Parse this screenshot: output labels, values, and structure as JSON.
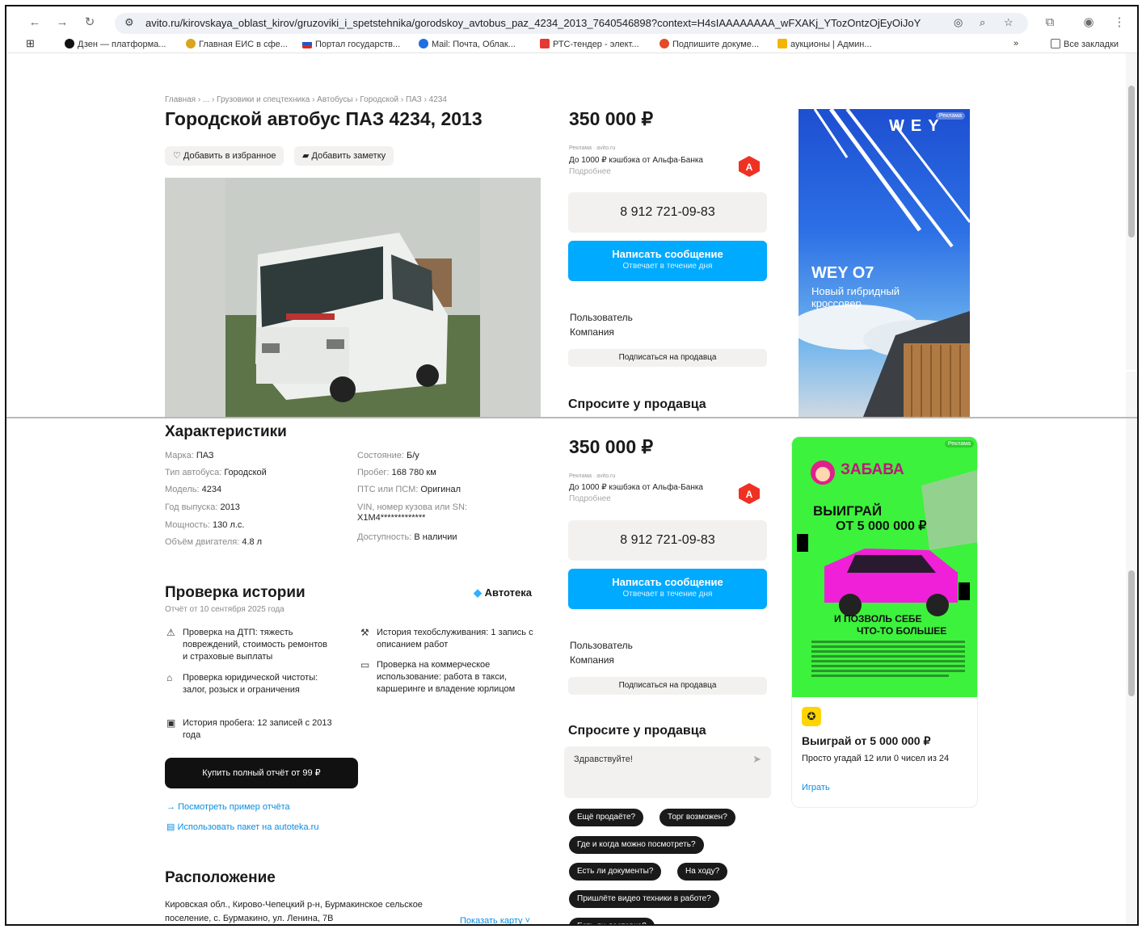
{
  "browser": {
    "url": "avito.ru/kirovskaya_oblast_kirov/gruzoviki_i_spetstehnika/gorodskoy_avtobus_paz_4234_2013_7640546898?context=H4sIAAAAAAAA_wFXAKj_YTozOntzOjEyOiJoYXNHZ...",
    "bookmarks": [
      "Дзен — платформа...",
      "Главная ЕИС в сфе...",
      "Портал государств...",
      "Mail: Почта, Облак...",
      "РТС-тендер - элект...",
      "Подпишите докуме...",
      "аукционы | Админ..."
    ],
    "all_bookmarks": "Все закладки",
    "colors": {
      "accent": "#00aaff",
      "dark": "#1a1a1a"
    }
  },
  "listing": {
    "breadcrumbs": "Главная › ... › Грузовики и спецтехника › Автобусы › Городской › ПАЗ › 4234",
    "title": "Городской автобус ПАЗ 4234, 2013",
    "fav_label": "Добавить в избранное",
    "note_label": "Добавить заметку"
  },
  "sidebar": {
    "price": "350 000 ₽",
    "ad_tag": "Реклама · avito.ru",
    "cashback": "До 1000 ₽ кэшбэка от Альфа-Банка",
    "more": "Подробнее",
    "phone": "8 912 721-09-83",
    "message": "Написать сообщение",
    "reply_time": "Отвечает в течение дня",
    "seller_role": "Пользователь",
    "seller_type": "Компания",
    "subscribe": "Подписаться на продавца",
    "ask_title": "Спросите у продавца",
    "chat_placeholder": "Здравствуйте!",
    "quick_questions": [
      "Ещё продаёте?",
      "Торг возможен?",
      "Где и когда можно посмотреть?",
      "Есть ли документы?",
      "На ходу?",
      "Пришлёте видео техники в работе?",
      "Есть ли доставка?"
    ]
  },
  "ad1": {
    "badge": "Реклама",
    "brand": "WEY",
    "model": "WEY O7",
    "slogan": "Новый гибридный кроссовер"
  },
  "specs": {
    "title": "Характеристики",
    "left": [
      {
        "k": "Марка:",
        "v": "ПАЗ"
      },
      {
        "k": "Тип автобуса:",
        "v": "Городской"
      },
      {
        "k": "Модель:",
        "v": "4234"
      },
      {
        "k": "Год выпуска:",
        "v": "2013"
      },
      {
        "k": "Мощность:",
        "v": "130 л.с."
      },
      {
        "k": "Объём двигателя:",
        "v": "4.8 л"
      }
    ],
    "right": [
      {
        "k": "Состояние:",
        "v": "Б/у"
      },
      {
        "k": "Пробег:",
        "v": "168 780 км"
      },
      {
        "k": "ПТС или ПСМ:",
        "v": "Оригинал"
      },
      {
        "k": "VIN, номер кузова или SN:",
        "v": "X1M4*************"
      },
      {
        "k": "Доступность:",
        "v": "В наличии"
      }
    ]
  },
  "history": {
    "title": "Проверка истории",
    "brand": "Автотека",
    "date": "Отчёт от 10 сентября 2025 года",
    "checks_left": [
      "Проверка на ДТП: тяжесть повреждений, стоимость ремонтов и страховые выплаты",
      "Проверка юридической чистоты: залог, розыск и ограничения",
      "История пробега: 12 записей с 2013 года"
    ],
    "checks_right": [
      "История техобслуживания: 1 запись с описанием работ",
      "Проверка на коммерческое использование: работа в такси, каршеринге и владение юрлицом"
    ],
    "buy": "Купить полный отчёт от 99 ₽",
    "example": "Посмотреть пример отчёта",
    "package": "Использовать пакет на autoteka.ru"
  },
  "location": {
    "title": "Расположение",
    "address": "Кировская обл., Кирово-Чепецкий р-н, Бурмакинское сельское поселение, с. Бурмакино, ул. Ленина, 7В",
    "show_map": "Показать карту"
  },
  "ad2": {
    "badge": "Реклама",
    "brand": "ЗАБАВА",
    "headline1": "ВЫИГРАЙ",
    "headline2": "ОТ 5 000 000 ₽",
    "tagline1": "И ПОЗВОЛЬ СЕБЕ",
    "tagline2": "ЧТО-ТО БОЛЬШЕЕ",
    "title": "Выиграй от 5 000 000 ₽",
    "text": "Просто угадай 12 или 0 чисел из 24",
    "cta": "Играть"
  }
}
